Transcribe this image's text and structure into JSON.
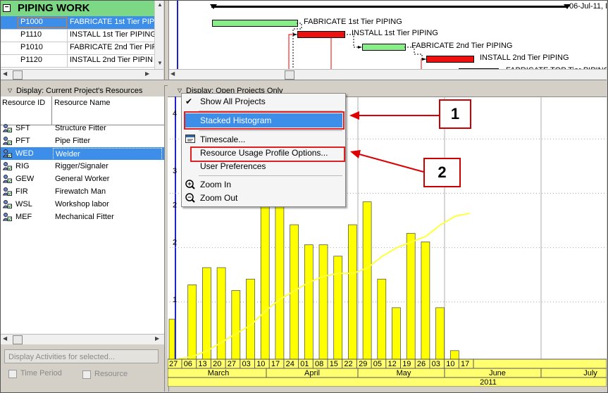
{
  "activity_table": {
    "wbs_collapse": "−",
    "wbs_title": "PIPING WORK",
    "rows": [
      {
        "id": "P1000",
        "name": "FABRICATE 1st Tier PIP",
        "selected": true
      },
      {
        "id": "P1110",
        "name": "INSTALL 1st Tier PIPING"
      },
      {
        "id": "P1010",
        "name": "FABRICATE 2nd Tier PIP"
      },
      {
        "id": "P1120",
        "name": "INSTALL 2nd Tier PIPIN"
      }
    ]
  },
  "gantt": {
    "date_label": "06-Jul-11, P",
    "bars": [
      {
        "label": "FABRICATE 1st Tier PIPING",
        "color": "green"
      },
      {
        "label": "INSTALL 1st Tier PIPING",
        "color": "red"
      },
      {
        "label": "FABRICATE 2nd Tier PIPING",
        "color": "green"
      },
      {
        "label": "INSTALL 2nd Tier PIPING",
        "color": "red"
      },
      {
        "label": "FABRICATE TOP Tier PIPING",
        "color": "red"
      }
    ]
  },
  "resources_panel": {
    "display_label": "Display: Current Project's Resources",
    "col_id": "Resource ID",
    "col_name": "Resource Name",
    "rows": [
      {
        "id": "SFT",
        "name": "Structure Fitter"
      },
      {
        "id": "PFT",
        "name": "Pipe Fitter"
      },
      {
        "id": "WED",
        "name": "Welder",
        "selected": true
      },
      {
        "id": "RIG",
        "name": "Rigger/Signaler"
      },
      {
        "id": "GEW",
        "name": "General Worker"
      },
      {
        "id": "FIR",
        "name": "Firewatch Man"
      },
      {
        "id": "WSL",
        "name": "Workshop labor"
      },
      {
        "id": "MEF",
        "name": "Mechanical  Fitter"
      }
    ],
    "display_activities_button": "Display Activities for selected...",
    "time_period_label": "Time Period",
    "resource_label": "Resource"
  },
  "histogram": {
    "display_label": "Display: Open Projects Only",
    "y_ticks": [
      "1",
      "2",
      "2",
      "3",
      "4"
    ],
    "x_ticks": [
      "27",
      "06",
      "13",
      "20",
      "27",
      "03",
      "10",
      "17",
      "24",
      "01",
      "08",
      "15",
      "22",
      "29",
      "05",
      "12",
      "19",
      "26",
      "03",
      "10",
      "17"
    ],
    "months": [
      "March",
      "April",
      "May",
      "June",
      "July"
    ],
    "year": "2011",
    "colors": {
      "bar": "#ffff00",
      "curve": "#ffff40",
      "accent": "#3d8ee8"
    }
  },
  "chart_data": {
    "type": "bar",
    "categories": [
      "27",
      "06",
      "13",
      "20",
      "27",
      "03",
      "10",
      "17",
      "24",
      "01",
      "08",
      "15",
      "22",
      "29",
      "05",
      "12",
      "19",
      "26",
      "03",
      "10",
      "17"
    ],
    "values": [
      0.7,
      1.3,
      1.6,
      1.6,
      1.2,
      1.4,
      4.0,
      2.7,
      2.35,
      2.0,
      2.0,
      1.8,
      2.35,
      2.75,
      1.4,
      0.9,
      2.2,
      2.05,
      0.9,
      0.15,
      0
    ],
    "cumulative_line": [
      0.0,
      0.05,
      0.15,
      0.3,
      0.45,
      0.6,
      0.85,
      1.05,
      1.2,
      1.35,
      1.45,
      1.5,
      1.5,
      1.6,
      1.8,
      1.95,
      2.05,
      2.15,
      2.35,
      2.5,
      2.55
    ],
    "ylim": [
      0,
      4.4
    ],
    "grid": true
  },
  "context_menu": {
    "items": [
      {
        "label": "Show All Projects",
        "icon": "check-icon"
      },
      {
        "label": "Stacked Histogram",
        "highlighted": true
      },
      {
        "label": "Timescale...",
        "icon": "timescale-icon"
      },
      {
        "label": "Resource Usage Profile Options..."
      },
      {
        "label": "User Preferences"
      },
      {
        "label": "Zoom In",
        "icon": "zoom-in-icon"
      },
      {
        "label": "Zoom Out",
        "icon": "zoom-out-icon"
      }
    ]
  },
  "callouts": [
    {
      "number": "1"
    },
    {
      "number": "2"
    }
  ]
}
